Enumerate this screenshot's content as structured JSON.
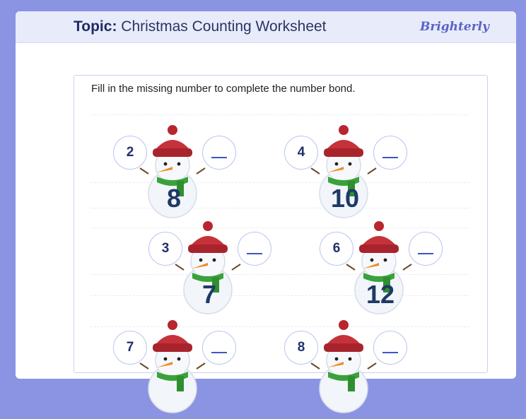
{
  "header": {
    "topic_label": "Topic:",
    "title": "Christmas Counting Worksheet",
    "logo": "Brighterly"
  },
  "instruction": "Fill in the missing number to complete the number bond.",
  "bonds": [
    {
      "part": "2",
      "whole": "8",
      "blank": "__"
    },
    {
      "part": "4",
      "whole": "10",
      "blank": "__"
    },
    {
      "part": "3",
      "whole": "7",
      "blank": "__"
    },
    {
      "part": "6",
      "whole": "12",
      "blank": "__"
    },
    {
      "part": "7",
      "whole": "",
      "blank": "__"
    },
    {
      "part": "8",
      "whole": "",
      "blank": "__"
    }
  ],
  "colors": {
    "background": "#8b93e3",
    "accent": "#3c55c6",
    "hat": "#c5323a",
    "scarf": "#3aa23a"
  },
  "icons": [
    "snowman-icon",
    "spiral-binding-icon"
  ]
}
